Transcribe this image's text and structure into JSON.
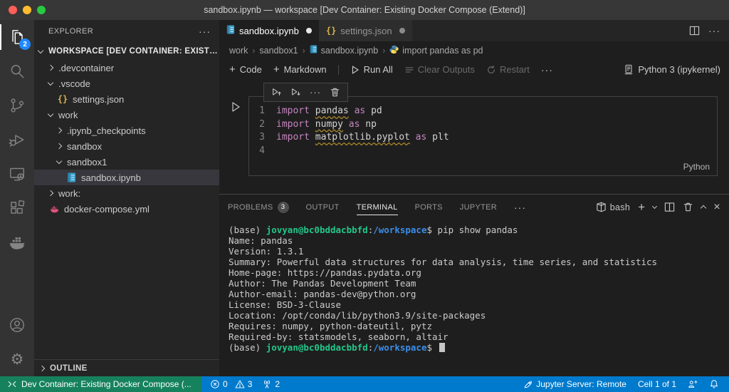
{
  "window": {
    "title": "sandbox.ipynb — workspace [Dev Container: Existing Docker Compose (Extend)]"
  },
  "activity_bar": {
    "explorer_badge": "2"
  },
  "explorer": {
    "title": "EXPLORER",
    "workspace_label": "WORKSPACE [DEV CONTAINER: EXISTIN...",
    "items": [
      {
        "label": ".devcontainer"
      },
      {
        "label": ".vscode"
      },
      {
        "label": "settings.json"
      },
      {
        "label": "work"
      },
      {
        "label": ".ipynb_checkpoints"
      },
      {
        "label": "sandbox"
      },
      {
        "label": "sandbox1"
      },
      {
        "label": "sandbox.ipynb"
      },
      {
        "label": "work:"
      },
      {
        "label": "docker-compose.yml"
      }
    ],
    "outline_label": "OUTLINE"
  },
  "editor": {
    "tabs": [
      {
        "label": "sandbox.ipynb"
      },
      {
        "label": "settings.json"
      }
    ],
    "breadcrumbs": [
      "work",
      "sandbox1",
      "sandbox.ipynb",
      "import pandas as pd"
    ]
  },
  "notebook": {
    "toolbar": {
      "add_code": "Code",
      "add_markdown": "Markdown",
      "run_all": "Run All",
      "clear_outputs": "Clear Outputs",
      "restart": "Restart"
    },
    "kernel": "Python 3 (ipykernel)",
    "cell": {
      "lines": [
        {
          "num": "1",
          "kw1": "import ",
          "name": "pandas",
          "kw2": " as ",
          "alias": "pd"
        },
        {
          "num": "2",
          "kw1": "import ",
          "name": "numpy",
          "kw2": " as ",
          "alias": "np"
        },
        {
          "num": "3",
          "kw1": "import ",
          "name": "matplotlib.pyplot",
          "kw2": " as ",
          "alias": "plt"
        },
        {
          "num": "4",
          "kw1": "",
          "name": "",
          "kw2": "",
          "alias": ""
        }
      ],
      "language": "Python"
    }
  },
  "panel": {
    "tabs": [
      "PROBLEMS",
      "OUTPUT",
      "TERMINAL",
      "PORTS",
      "JUPYTER"
    ],
    "problems_badge": "3",
    "shell": "bash"
  },
  "terminal": {
    "prompt_prefix": "(base) ",
    "prompt_user": "jovyan@bc0bddacbbfd",
    "prompt_sep": ":",
    "prompt_path": "/workspace",
    "prompt_dollar": "$ ",
    "command": "pip show pandas",
    "output": [
      "Name: pandas",
      "Version: 1.3.1",
      "Summary: Powerful data structures for data analysis, time series, and statistics",
      "Home-page: https://pandas.pydata.org",
      "Author: The Pandas Development Team",
      "Author-email: pandas-dev@python.org",
      "License: BSD-3-Clause",
      "Location: /opt/conda/lib/python3.9/site-packages",
      "Requires: numpy, python-dateutil, pytz",
      "Required-by: statsmodels, seaborn, altair"
    ]
  },
  "status_bar": {
    "remote": "Dev Container: Existing Docker Compose (...",
    "errors": "0",
    "warnings": "3",
    "ports": "2",
    "jupyter": "Jupyter Server: Remote",
    "cell_indicator": "Cell 1 of 1"
  }
}
